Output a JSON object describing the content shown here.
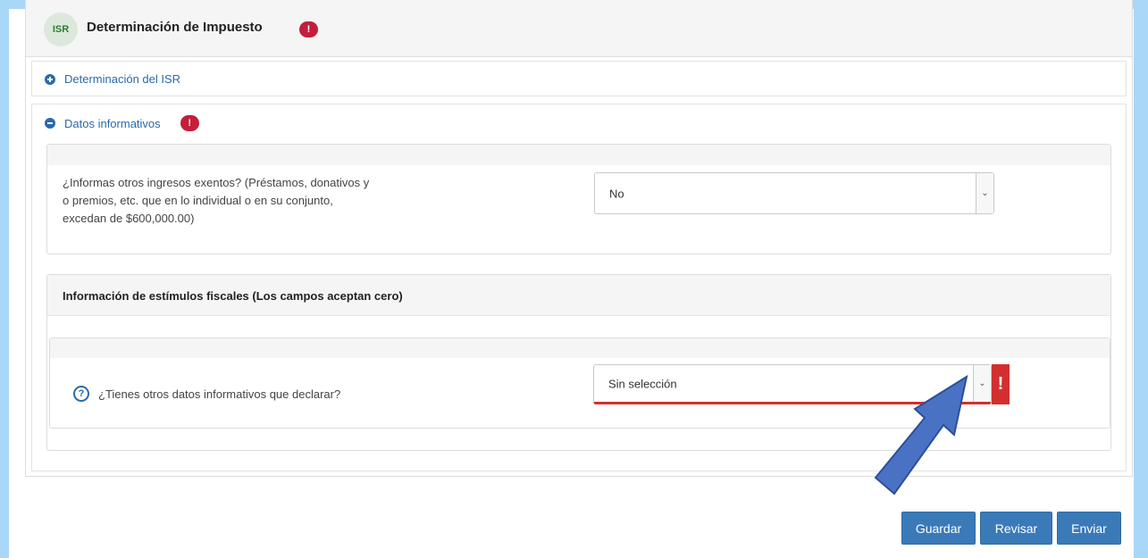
{
  "header": {
    "badge": "ISR",
    "title": "Determinación de Impuesto",
    "error_count": "!"
  },
  "sections": {
    "isr": {
      "label": "Determinación del ISR",
      "icon": "plus-circle-icon"
    },
    "datos": {
      "label": "Datos informativos",
      "icon": "minus-circle-icon",
      "error_count": "!"
    }
  },
  "question1": {
    "text_line1": "¿Informas otros ingresos exentos? (Préstamos, donativos y",
    "text_line2": "o premios, etc. que en lo individual o en su conjunto,",
    "text_line3": "excedan de $600,000.00)",
    "value": "No"
  },
  "estimulos": {
    "title": "Información de estímulos fiscales (Los campos aceptan cero)",
    "question": "¿Tienes otros datos informativos que declarar?",
    "value": "Sin selección",
    "error_mark": "!"
  },
  "actions": {
    "save": "Guardar",
    "review": "Revisar",
    "send": "Enviar"
  },
  "colors": {
    "frame": "#a9d7f7",
    "accent": "#3a7ab8",
    "error": "#c41e3a",
    "link": "#2a6aab",
    "arrow": "#4a72c4"
  }
}
